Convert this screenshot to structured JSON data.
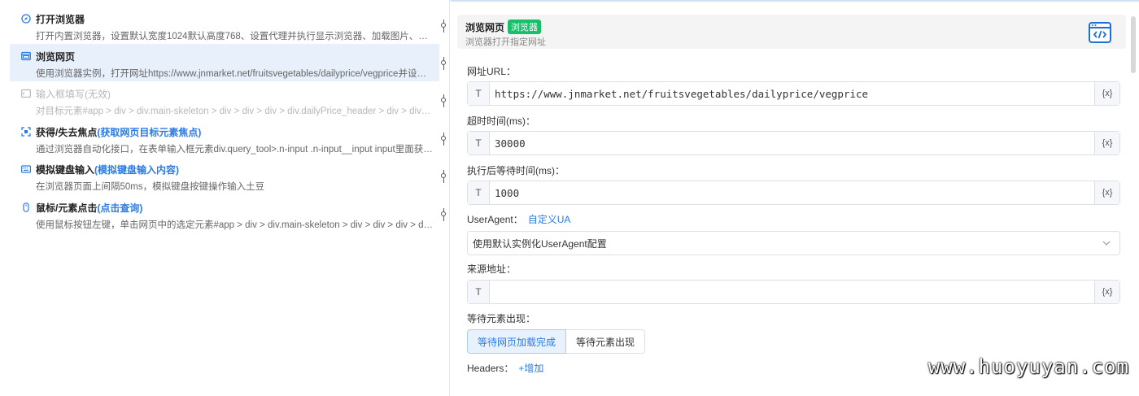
{
  "steps": [
    {
      "title": "打开浏览器",
      "tag": "",
      "desc": "打开内置浏览器，设置默认宽度1024默认高度768、设置代理并执行显示浏览器、加载图片、…",
      "icon": "compass-icon"
    },
    {
      "title": "浏览网页",
      "tag": "",
      "desc": "使用浏览器实例，打开网址https://www.jnmarket.net/fruitsvegetables/dailyprice/vegprice并设…",
      "icon": "browser-window-icon"
    },
    {
      "title": "输入框填写(无效)",
      "tag": "",
      "desc": "对目标元素#app > div > div.main-skeleton > div > div > div > div.dailyPrice_header > div > div…",
      "icon": "input-box-icon"
    },
    {
      "title": "获得/失去焦点",
      "tag": "(获取网页目标元素焦点)",
      "desc": "通过浏览器自动化接口，在表单输入框元素div.query_tool>.n-input .n-input__input input里面获…",
      "icon": "focus-icon"
    },
    {
      "title": "模拟键盘输入",
      "tag": "(模拟键盘输入内容)",
      "desc": "在浏览器页面上间隔50ms，模拟键盘按键操作输入土豆",
      "icon": "keyboard-icon"
    },
    {
      "title": "鼠标/元素点击",
      "tag": "(点击查询)",
      "desc": "使用鼠标按钮左键，单击网页中的选定元素#app > div > div.main-skeleton > div > div > div > di…",
      "icon": "mouse-icon"
    }
  ],
  "panel": {
    "title": "浏览网页",
    "badge": "浏览器",
    "subtitle": "浏览器打开指定网址",
    "url_label": "网址URL：",
    "url_prefix": "T",
    "url_value": "https://www.jnmarket.net/fruitsvegetables/dailyprice/vegprice",
    "var_suffix": "{x}",
    "timeout_label": "超时时间(ms)：",
    "timeout_value": "30000",
    "wait_label": "执行后等待时间(ms)：",
    "wait_value": "1000",
    "ua_label": "UserAgent：",
    "ua_link": "自定义UA",
    "ua_select": "使用默认实例化UserAgent配置",
    "referer_label": "来源地址：",
    "referer_value": "",
    "wait_elem_label": "等待元素出现：",
    "wait_btn_1": "等待网页加载完成",
    "wait_btn_2": "等待元素出现",
    "headers_label": "Headers：",
    "headers_add": "+增加"
  },
  "watermark": "www.huoyuyan.com",
  "colors": {
    "accent": "#2c7be5",
    "badge": "#19be6b",
    "selected_bg": "#e8f0fb"
  }
}
